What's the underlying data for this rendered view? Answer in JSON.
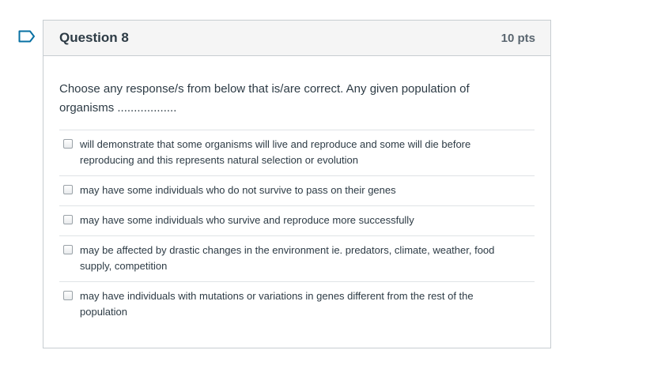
{
  "question": {
    "title": "Question 8",
    "points": "10 pts",
    "text": "Choose any response/s from below that is/are correct.  Any given population of organisms ..................",
    "flag_icon": "bookmark-flag-icon",
    "accent_color": "#0770a3"
  },
  "answers": [
    {
      "label": "will demonstrate that some organisms will live and reproduce and some will die before reproducing and this represents natural selection or evolution",
      "checked": false
    },
    {
      "label": "may have some individuals who do not survive to pass on their genes",
      "checked": false
    },
    {
      "label": "may have some individuals who survive and reproduce more successfully",
      "checked": false
    },
    {
      "label": "may be affected by drastic changes in the environment ie. predators, climate, weather, food supply, competition",
      "checked": false
    },
    {
      "label": "may have individuals with mutations or variations in genes different from the rest of the population",
      "checked": false
    }
  ]
}
